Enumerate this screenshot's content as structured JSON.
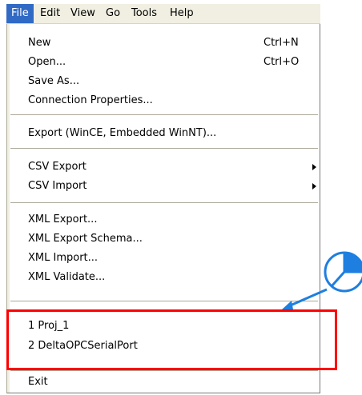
{
  "menubar": {
    "items": [
      {
        "label": "File"
      },
      {
        "label": "Edit"
      },
      {
        "label": "View"
      },
      {
        "label": "Go"
      },
      {
        "label": "Tools"
      },
      {
        "label": "Help"
      }
    ]
  },
  "file_menu": {
    "new": {
      "label": "New",
      "shortcut": "Ctrl+N"
    },
    "open": {
      "label": "Open...",
      "shortcut": "Ctrl+O"
    },
    "save_as": {
      "label": "Save As..."
    },
    "connection_properties": {
      "label": "Connection Properties..."
    },
    "export_wince": {
      "label": "Export (WinCE, Embedded WinNT)..."
    },
    "csv_export": {
      "label": "CSV Export"
    },
    "csv_import": {
      "label": "CSV Import"
    },
    "xml_export": {
      "label": "XML Export..."
    },
    "xml_export_schema": {
      "label": "XML Export Schema..."
    },
    "xml_import": {
      "label": "XML Import..."
    },
    "xml_validate": {
      "label": "XML Validate..."
    },
    "recent_files": [
      {
        "label": "1 Proj_1"
      },
      {
        "label": "2 DeltaOPCSerialPort"
      }
    ],
    "exit": {
      "label": "Exit"
    }
  },
  "colors": {
    "menu_highlight": "#316ac5",
    "menubar_bg": "#f1efe2",
    "callout_border": "#ff0000",
    "pointer_blue": "#1e7fe0"
  },
  "annotation": {
    "icon": "clock-icon"
  }
}
